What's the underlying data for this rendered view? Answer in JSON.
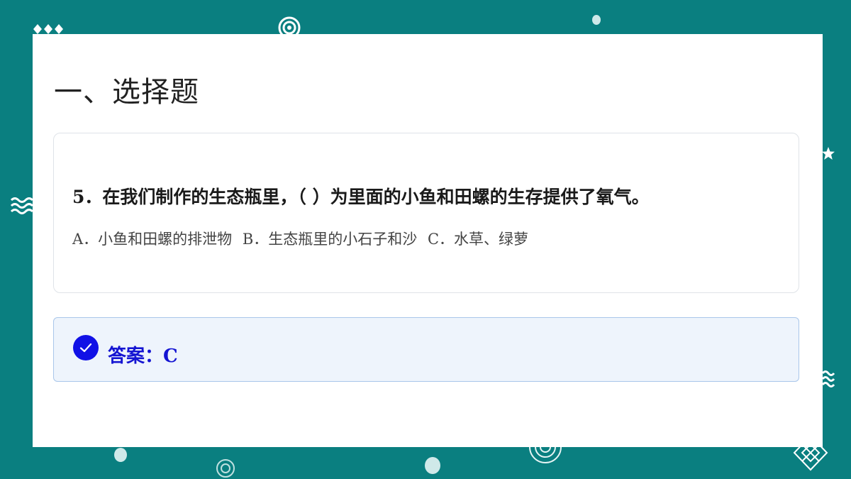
{
  "heading": "一、选择题",
  "question": {
    "text": "5．在我们制作的生态瓶里，（  ）为里面的小鱼和田螺的生存提供了氧气。",
    "options": [
      "A．小鱼和田螺的排泄物",
      "B．生态瓶里的小石子和沙",
      "C．水草、绿萝"
    ]
  },
  "answer": {
    "text": "答案：C",
    "icon": "check-circle-icon",
    "color": "#1414d2"
  },
  "colors": {
    "background": "#0a7f80",
    "card_border": "#dfe3e8",
    "answer_bg": "#eef4fc",
    "answer_border": "#a9c6ea"
  }
}
